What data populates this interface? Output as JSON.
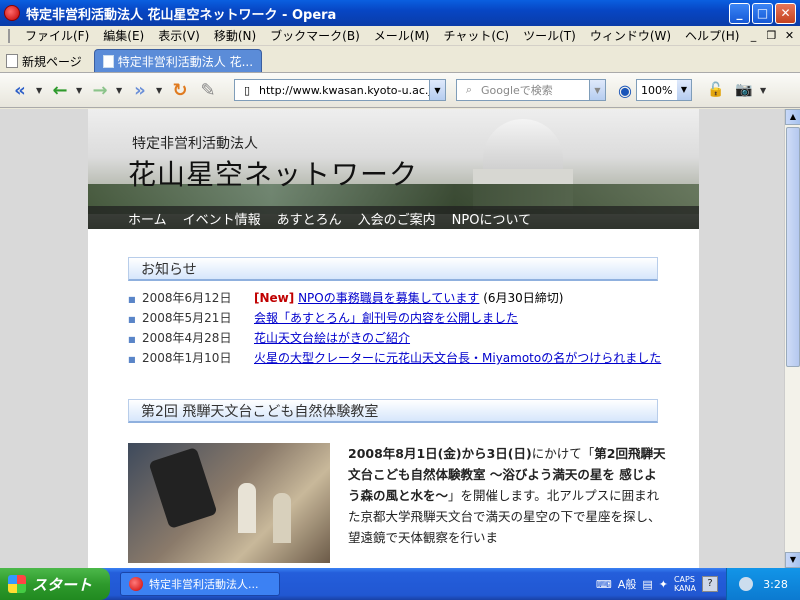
{
  "window": {
    "title": "特定非営利活動法人 花山星空ネットワーク - Opera",
    "minimize": "_",
    "maximize": "□",
    "close": "✕"
  },
  "menu": {
    "items": [
      "ファイル(F)",
      "編集(E)",
      "表示(V)",
      "移動(N)",
      "ブックマーク(B)",
      "メール(M)",
      "チャット(C)",
      "ツール(T)",
      "ウィンドウ(W)",
      "ヘルプ(H)"
    ]
  },
  "tabs": {
    "new_page_label": "新規ページ",
    "active_tab_label": "特定非営利活動法人 花..."
  },
  "toolbar": {
    "url": "http://www.kwasan.kyoto-u.ac.jp/h",
    "search_placeholder": "Googleで検索",
    "zoom": "100%"
  },
  "page": {
    "org_sub": "特定非営利活動法人",
    "org_name": "花山星空ネットワーク",
    "nav": [
      "ホーム",
      "イベント情報",
      "あすとろん",
      "入会のご案内",
      "NPOについて"
    ],
    "news_title": "お知らせ",
    "news": [
      {
        "date": "2008年6月12日",
        "badge": "[New]",
        "link": "NPOの事務職員を募集しています",
        "suffix": " (6月30日締切)"
      },
      {
        "date": "2008年5月21日",
        "badge": "",
        "link": "会報「あすとろん」創刊号の内容を公開しました",
        "suffix": ""
      },
      {
        "date": "2008年4月28日",
        "badge": "",
        "link": "花山天文台絵はがきのご紹介",
        "suffix": ""
      },
      {
        "date": "2008年1月10日",
        "badge": "",
        "link": "火星の大型クレーターに元花山天文台長・Miyamotoの名がつけられました",
        "suffix": ""
      }
    ],
    "event_title": "第2回 飛騨天文台こども自然体験教室",
    "event_text_bold1": "2008年8月1日(金)から3日(日)",
    "event_text_mid": "にかけて「",
    "event_text_bold2": "第2回飛騨天文台こども自然体験教室 ～浴びよう満天の星を 感じよう森の風と水を～",
    "event_text_rest": "」を開催します。北アルプスに囲まれた京都大学飛騨天文台で満天の星空の下で星座を探し、望遠鏡で天体観察を行いま"
  },
  "taskbar": {
    "start_label": "スタート",
    "task_label": "特定非営利活動法人...",
    "ime_label": "A般",
    "caps": "CAPS",
    "kana": "KANA",
    "help": "?",
    "clock": "3:28"
  },
  "colors": {
    "titlebar": "#0a5fe0",
    "link": "#0000cc",
    "new_badge": "#c00000",
    "section_bar": "#d6e6fb",
    "start_button": "#2e9a2c"
  }
}
